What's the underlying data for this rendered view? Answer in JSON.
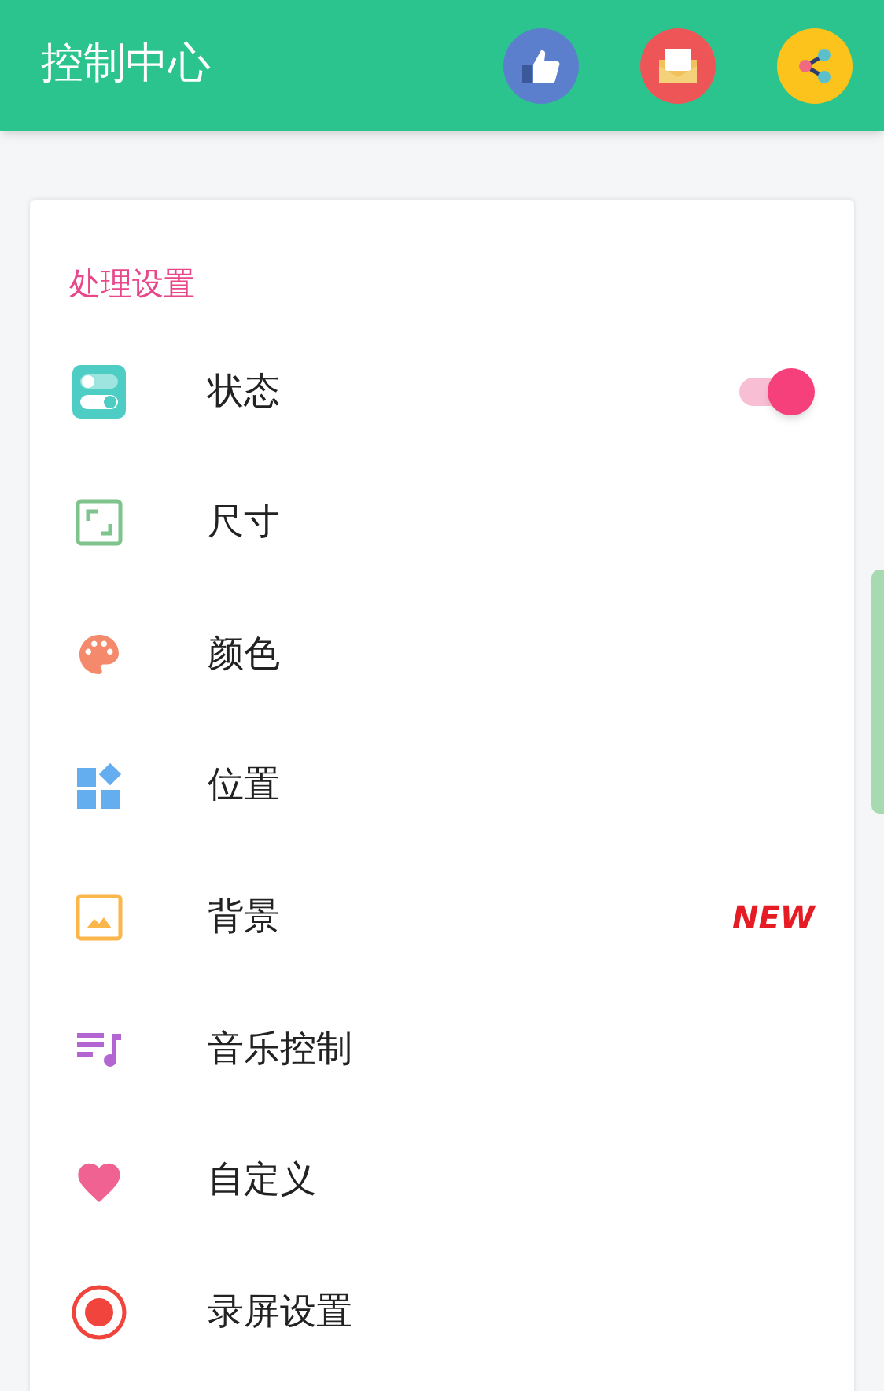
{
  "header": {
    "title": "控制中心"
  },
  "section": {
    "title": "处理设置"
  },
  "items": [
    {
      "label": "状态",
      "kind": "switch",
      "on": true
    },
    {
      "label": "尺寸",
      "kind": "plain"
    },
    {
      "label": "颜色",
      "kind": "plain"
    },
    {
      "label": "位置",
      "kind": "plain"
    },
    {
      "label": "背景",
      "kind": "badge",
      "badge": "NEW"
    },
    {
      "label": "音乐控制",
      "kind": "plain"
    },
    {
      "label": "自定义",
      "kind": "plain"
    },
    {
      "label": "录屏设置",
      "kind": "plain"
    }
  ]
}
